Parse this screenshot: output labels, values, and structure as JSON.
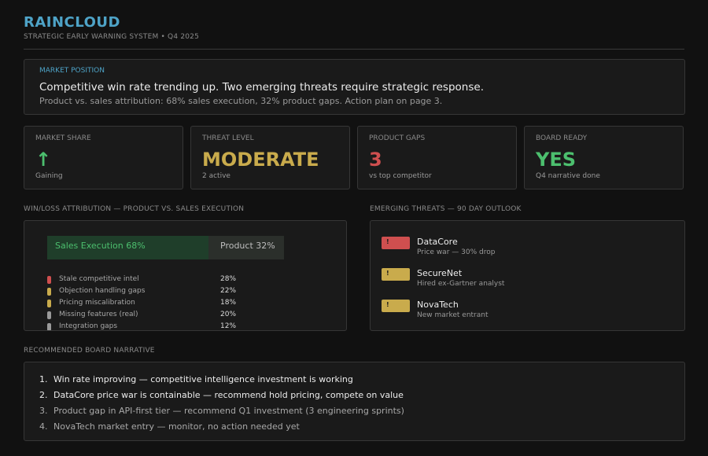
{
  "header": {
    "brand": "RAINCLOUD",
    "subtitle": "STRATEGIC EARLY WARNING SYSTEM  •  Q4 2025"
  },
  "market_position": {
    "label": "MARKET POSITION",
    "headline": "Competitive win rate trending up. Two emerging threats require strategic response.",
    "detail": "Product vs. sales attribution: 68% sales execution, 32% product gaps. Action plan on page 3."
  },
  "kpis": [
    {
      "label": "MARKET SHARE",
      "value": "↑",
      "caption": "Gaining",
      "color": "#4cbf6e"
    },
    {
      "label": "THREAT LEVEL",
      "value": "MODERATE",
      "caption": "2 active",
      "color": "#c9ab4c"
    },
    {
      "label": "PRODUCT GAPS",
      "value": "3",
      "caption": "vs top competitor",
      "color": "#cf4f4f"
    },
    {
      "label": "BOARD READY",
      "value": "YES",
      "caption": "Q4 narrative done",
      "color": "#4cbf6e"
    }
  ],
  "attribution": {
    "section_label": "WIN/LOSS ATTRIBUTION — PRODUCT VS. SALES EXECUTION",
    "sales_label": "Sales Execution 68%",
    "product_label": "Product 32%",
    "sales_share": 68,
    "product_share": 32,
    "rows": [
      {
        "label": "Stale competitive intel",
        "pct": "28%",
        "color": "#cf4f4f"
      },
      {
        "label": "Objection handling gaps",
        "pct": "22%",
        "color": "#c9ab4c"
      },
      {
        "label": "Pricing miscalibration",
        "pct": "18%",
        "color": "#c9ab4c"
      },
      {
        "label": "Missing features (real)",
        "pct": "20%",
        "color": "#9a9a9a"
      },
      {
        "label": "Integration gaps",
        "pct": "12%",
        "color": "#9a9a9a"
      }
    ]
  },
  "threats": {
    "section_label": "EMERGING THREATS — 90 DAY OUTLOOK",
    "items": [
      {
        "badge": "!",
        "name": "DataCore",
        "desc": "Price war — 30% drop",
        "color": "#cf4f4f"
      },
      {
        "badge": "!",
        "name": "SecureNet",
        "desc": "Hired ex-Gartner analyst",
        "color": "#c9ab4c"
      },
      {
        "badge": "!",
        "name": "NovaTech",
        "desc": "New market entrant",
        "color": "#c9ab4c"
      }
    ]
  },
  "narrative": {
    "section_label": "RECOMMENDED BOARD NARRATIVE",
    "items": [
      {
        "num": "1.",
        "text": "Win rate improving — competitive intelligence investment is working"
      },
      {
        "num": "2.",
        "text": "DataCore price war is containable — recommend hold pricing, compete on value"
      },
      {
        "num": "3.",
        "text": "Product gap in API-first tier — recommend Q1 investment (3 engineering sprints)"
      },
      {
        "num": "4.",
        "text": "NovaTech market entry — monitor, no action needed yet"
      }
    ]
  }
}
